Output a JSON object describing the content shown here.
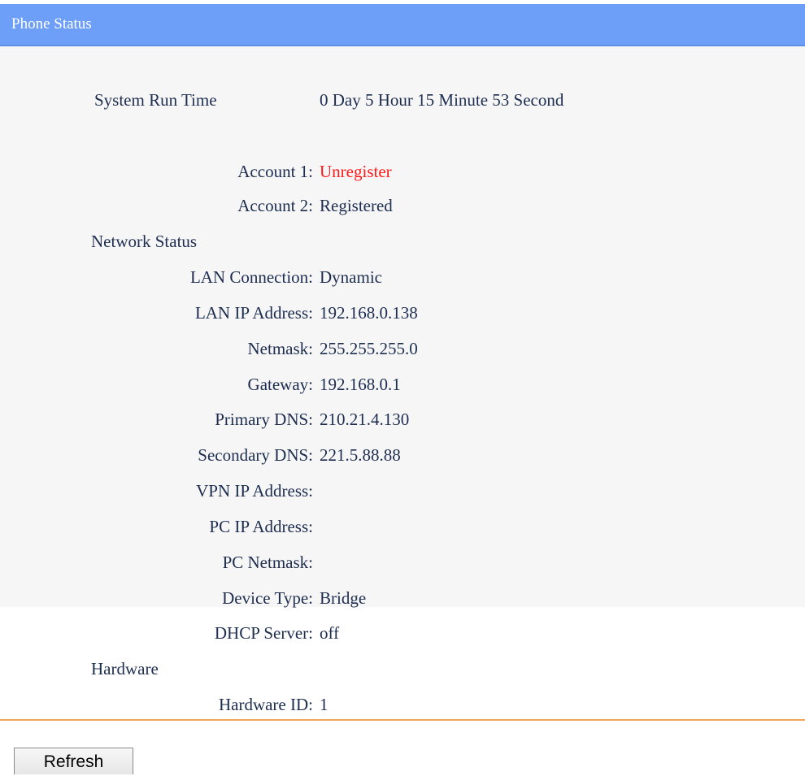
{
  "header": {
    "title": "Phone Status"
  },
  "runtime": {
    "label": "System Run Time",
    "value": "0 Day 5 Hour 15 Minute 53 Second"
  },
  "accounts": [
    {
      "label": "Account 1:",
      "value": "Unregister",
      "status_color": "#ff1a1a"
    },
    {
      "label": "Account 2:",
      "value": "Registered"
    }
  ],
  "network": {
    "section_label": "Network Status",
    "rows": [
      {
        "label": "LAN Connection:",
        "value": "Dynamic"
      },
      {
        "label": "LAN IP Address:",
        "value": "192.168.0.138"
      },
      {
        "label": "Netmask:",
        "value": "255.255.255.0"
      },
      {
        "label": "Gateway:",
        "value": "192.168.0.1"
      },
      {
        "label": "Primary DNS:",
        "value": "210.21.4.130"
      },
      {
        "label": "Secondary DNS:",
        "value": "221.5.88.88"
      },
      {
        "label": "VPN IP Address:",
        "value": ""
      },
      {
        "label": "PC IP Address:",
        "value": ""
      },
      {
        "label": "PC Netmask:",
        "value": ""
      },
      {
        "label": "Device Type:",
        "value": "Bridge"
      },
      {
        "label": "DHCP Server:",
        "value": "off"
      }
    ]
  },
  "hardware": {
    "section_label": "Hardware",
    "rows": [
      {
        "label": "Hardware ID:",
        "value": "1"
      }
    ]
  },
  "actions": {
    "refresh_label": "Refresh"
  },
  "colors": {
    "header_bg": "#6d9ff8",
    "divider": "#f0a55a",
    "text": "#1d2d4f",
    "unregister": "#ff1a1a"
  }
}
